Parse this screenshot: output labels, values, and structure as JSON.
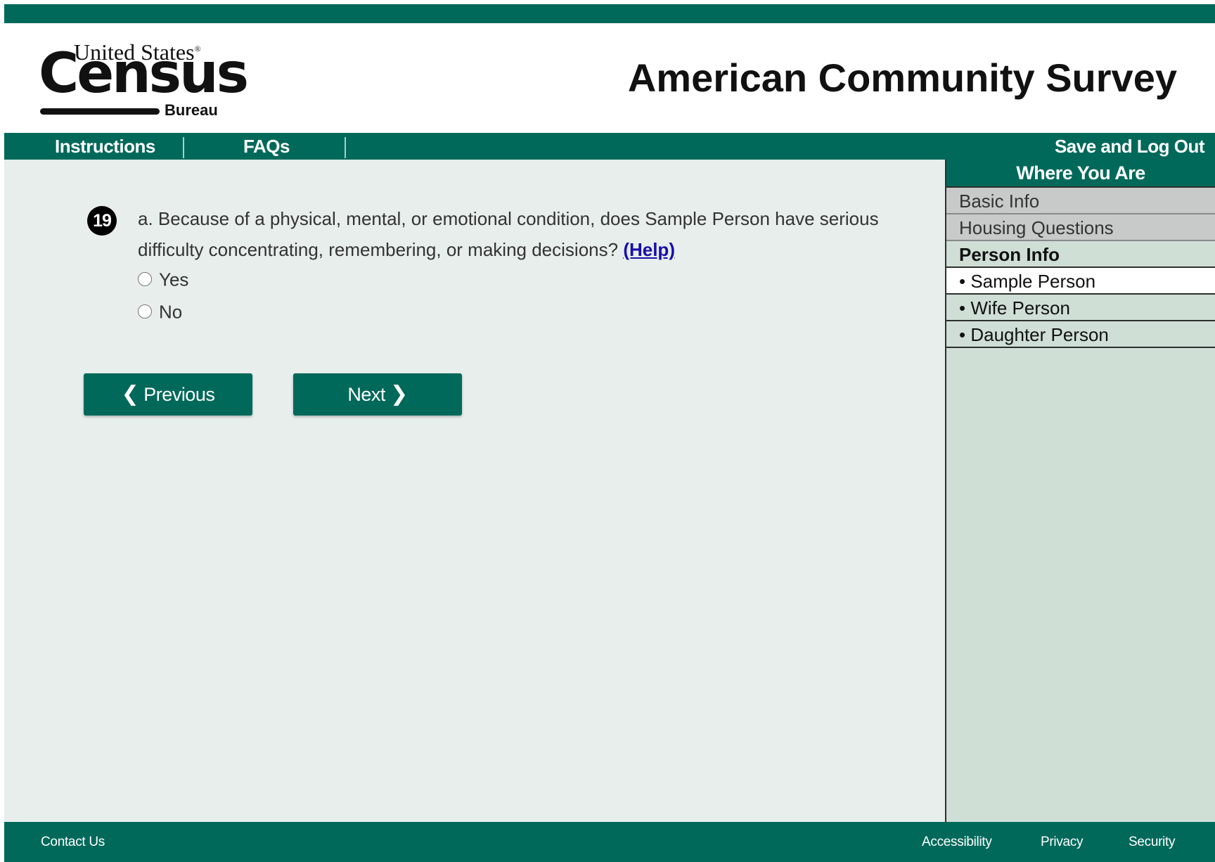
{
  "colors": {
    "brand_green": "#01695a",
    "content_bg": "#e7eeeb",
    "sidebar_bg": "#cfdfd6",
    "completed_row_bg": "#c7cac9",
    "help_link": "#1a0dab"
  },
  "header": {
    "logo": {
      "line1": "United States",
      "registered": "®",
      "line2": "Census",
      "line3": "Bureau"
    },
    "site_title": "American Community Survey"
  },
  "nav": {
    "items": [
      {
        "label": "Instructions"
      },
      {
        "label": "FAQs"
      }
    ],
    "save_logout": "Save and Log Out"
  },
  "question": {
    "number": "19",
    "text": "a. Because of a physical, mental, or emotional condition, does Sample Person have serious difficulty concentrating, remembering, or making decisions?",
    "help_label": "(Help)",
    "options": [
      {
        "label": "Yes",
        "selected": false
      },
      {
        "label": "No",
        "selected": false
      }
    ]
  },
  "buttons": {
    "previous_label": "Previous",
    "previous_icon": "chevron-left-icon",
    "next_label": "Next",
    "next_icon": "chevron-right-icon"
  },
  "sidebar": {
    "title": "Where You Are",
    "sections": [
      {
        "label": "Basic Info",
        "state": "completed"
      },
      {
        "label": "Housing Questions",
        "state": "completed"
      },
      {
        "label": "Person Info",
        "state": "active"
      }
    ],
    "persons": [
      {
        "label": "• Sample Person",
        "current": true
      },
      {
        "label": "• Wife Person",
        "current": false
      },
      {
        "label": "• Daughter Person",
        "current": false
      }
    ]
  },
  "footer": {
    "contact": "Contact Us",
    "links": [
      {
        "label": "Accessibility"
      },
      {
        "label": "Privacy"
      },
      {
        "label": "Security"
      }
    ]
  }
}
